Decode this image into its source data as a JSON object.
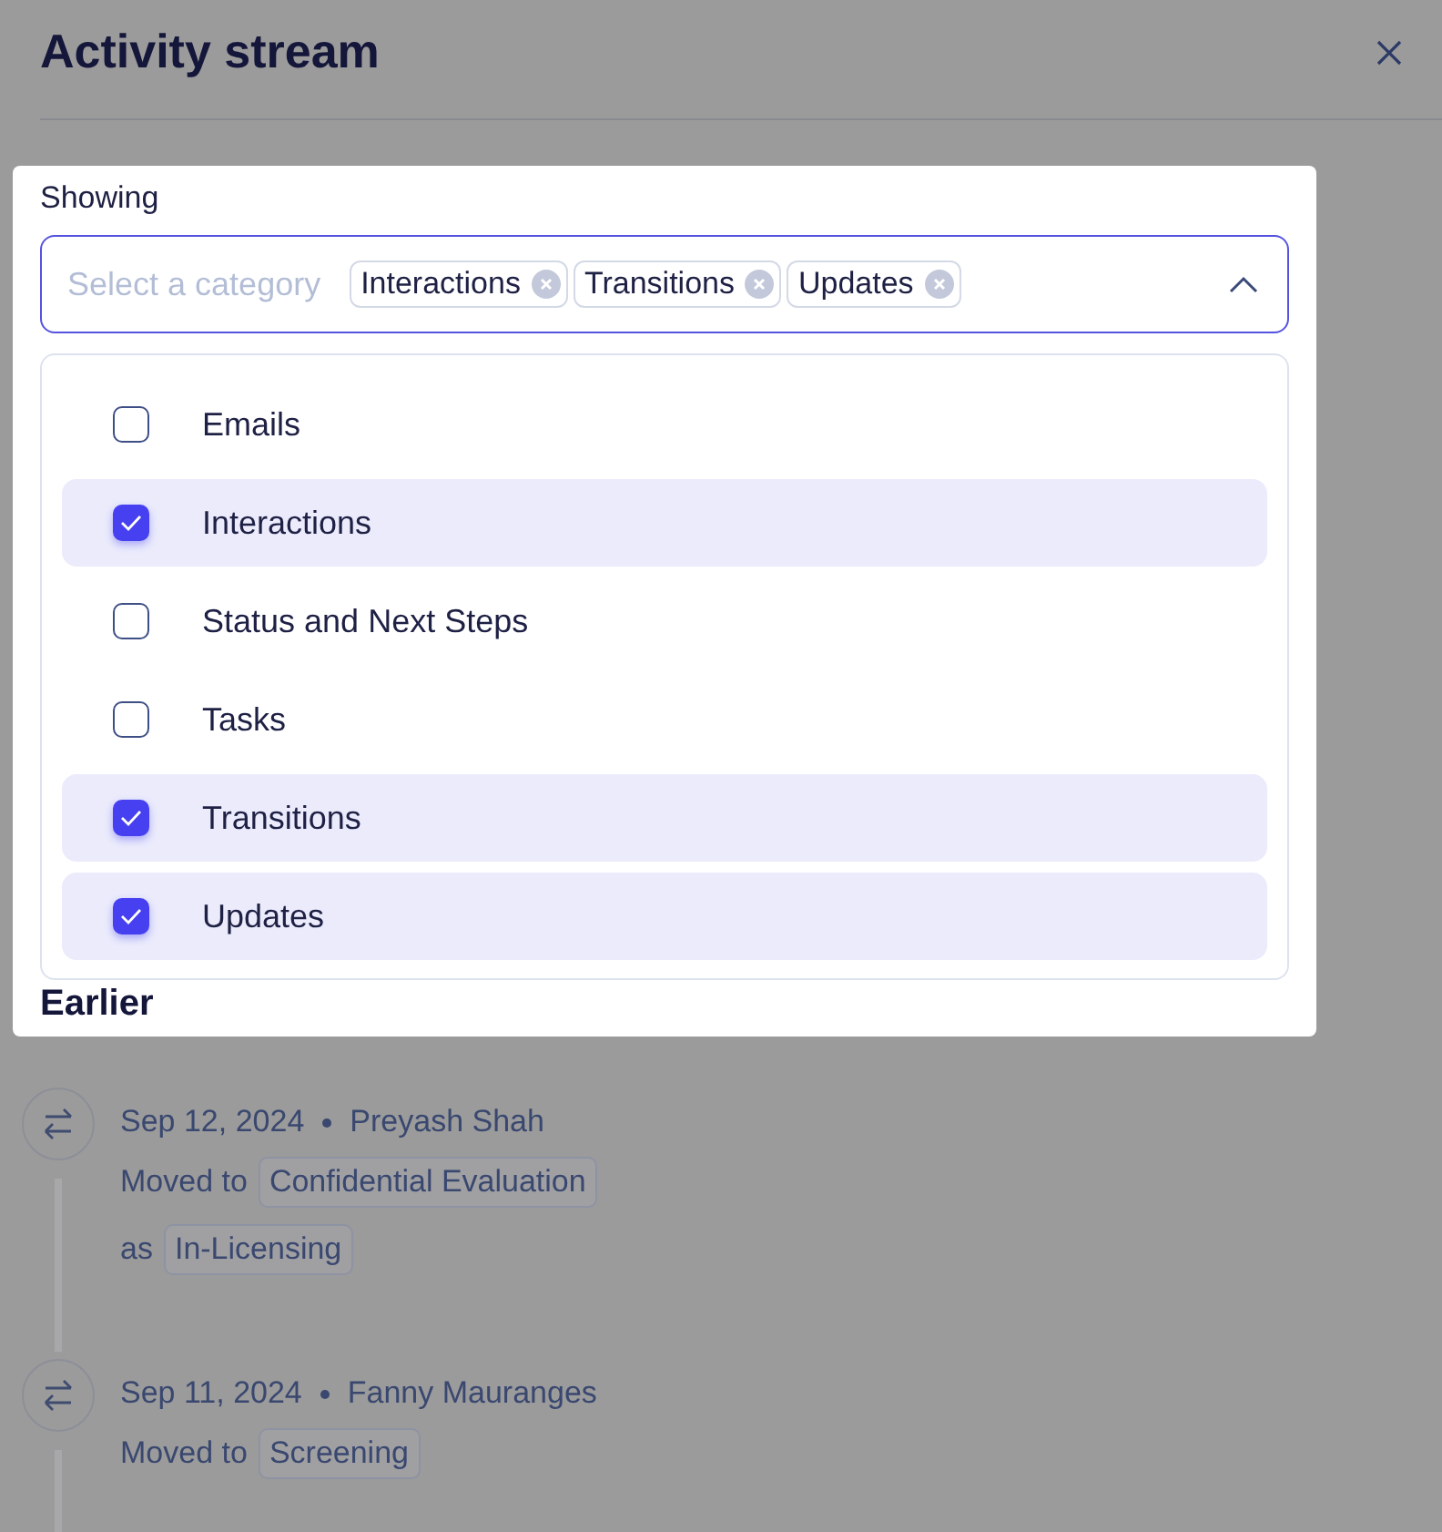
{
  "drawer": {
    "title": "Activity stream"
  },
  "filter": {
    "label": "Showing",
    "placeholder": "Select a category",
    "expanded": true,
    "chips": [
      {
        "label": "Interactions"
      },
      {
        "label": "Transitions"
      },
      {
        "label": "Updates"
      }
    ],
    "options": [
      {
        "label": "Emails",
        "checked": false
      },
      {
        "label": "Interactions",
        "checked": true
      },
      {
        "label": "Status and Next Steps",
        "checked": false
      },
      {
        "label": "Tasks",
        "checked": false
      },
      {
        "label": "Transitions",
        "checked": true
      },
      {
        "label": "Updates",
        "checked": true
      }
    ]
  },
  "section_heading": "Earlier",
  "activities": [
    {
      "date": "Sep 12, 2024",
      "author": "Preyash Shah",
      "lines": [
        {
          "prefix": "Moved to",
          "tag": "Confidential Evaluation"
        },
        {
          "prefix": "as",
          "tag": "In-Licensing"
        }
      ]
    },
    {
      "date": "Sep 11, 2024",
      "author": "Fanny Mauranges",
      "lines": [
        {
          "prefix": "Moved to",
          "tag": "Screening"
        }
      ]
    }
  ]
}
